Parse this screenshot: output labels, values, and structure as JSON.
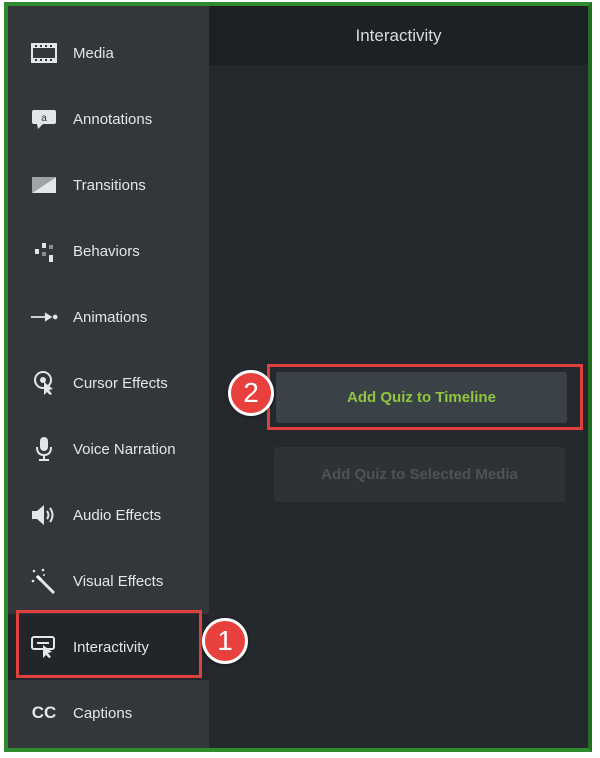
{
  "panel": {
    "title": "Interactivity"
  },
  "sidebar": {
    "items": [
      {
        "label": "Media",
        "icon": "film-strip-icon"
      },
      {
        "label": "Annotations",
        "icon": "annotation-callout-icon"
      },
      {
        "label": "Transitions",
        "icon": "transition-wedge-icon"
      },
      {
        "label": "Behaviors",
        "icon": "behaviors-bars-icon"
      },
      {
        "label": "Animations",
        "icon": "animation-arrow-icon"
      },
      {
        "label": "Cursor Effects",
        "icon": "cursor-spotlight-icon"
      },
      {
        "label": "Voice Narration",
        "icon": "microphone-icon"
      },
      {
        "label": "Audio Effects",
        "icon": "speaker-icon"
      },
      {
        "label": "Visual Effects",
        "icon": "magic-wand-icon"
      },
      {
        "label": "Interactivity",
        "icon": "interactivity-cursor-icon",
        "active": true
      },
      {
        "label": "Captions",
        "icon": "cc-icon",
        "icon_text": "CC"
      }
    ]
  },
  "actions": {
    "add_quiz_timeline": "Add Quiz to Timeline",
    "add_quiz_media": "Add Quiz to Selected Media"
  },
  "annotations": {
    "step1": "1",
    "step2": "2",
    "color": "#e8403d"
  },
  "colors": {
    "accent_green": "#8ec63f",
    "frame_green": "#2e8b2e"
  }
}
